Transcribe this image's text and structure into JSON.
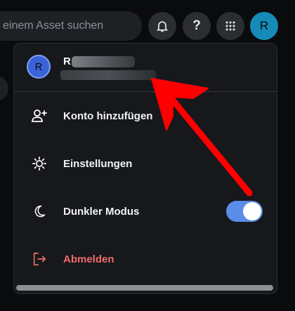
{
  "topbar": {
    "search_placeholder": "einem Asset suchen",
    "avatar_letter": "R",
    "help_glyph": "?"
  },
  "menu": {
    "profile": {
      "avatar_letter": "R",
      "name_visible": "R"
    },
    "items": [
      {
        "label": "Konto hinzufügen",
        "icon": "person-add-icon"
      },
      {
        "label": "Einstellungen",
        "icon": "gear-icon"
      },
      {
        "label": "Dunkler Modus",
        "icon": "moon-icon",
        "toggle_on": true
      },
      {
        "label": "Abmelden",
        "icon": "logout-icon"
      }
    ]
  },
  "colors": {
    "accent": "#5b8de8",
    "avatar": "#168bb7",
    "logout": "#ef6b6b",
    "annotation_arrow": "#ff0000"
  }
}
